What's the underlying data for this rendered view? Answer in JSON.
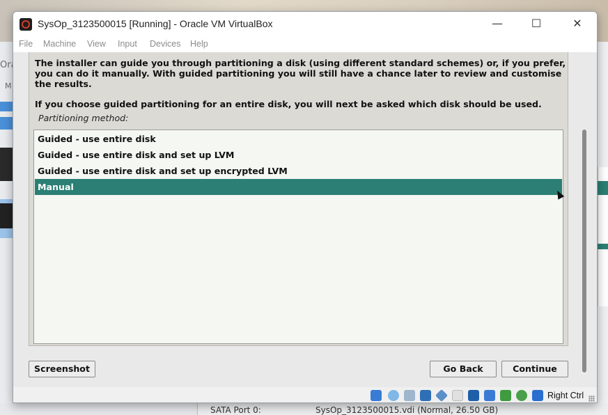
{
  "background": {
    "left_fragments": [
      "Ora",
      "M"
    ],
    "bottom_info": {
      "label": "SATA Port 0:",
      "value": "SysOp_3123500015.vdi (Normal, 26.50 GB)"
    }
  },
  "window": {
    "title": "SysOp_3123500015 [Running] - Oracle VM VirtualBox",
    "controls": {
      "minimize": "—",
      "maximize": "☐",
      "close": "✕"
    },
    "menu": [
      "File",
      "Machine",
      "View",
      "Input",
      "Devices",
      "Help"
    ]
  },
  "installer": {
    "intro": "The installer can guide you through partitioning a disk (using different standard schemes) or, if you prefer, you can do it manually. With guided partitioning you will still have a chance later to review and customise the results.",
    "intro2": "If you choose guided partitioning for an entire disk, you will next be asked which disk should be used.",
    "method_label": "Partitioning method:",
    "options": [
      "Guided - use entire disk",
      "Guided - use entire disk and set up LVM",
      "Guided - use entire disk and set up encrypted LVM",
      "Manual"
    ],
    "selected_index": 3,
    "buttons": {
      "screenshot": "Screenshot",
      "go_back": "Go Back",
      "continue": "Continue"
    }
  },
  "statusbar": {
    "icons": [
      "hard-disk-icon",
      "optical-drive-icon",
      "audio-icon",
      "network-icon",
      "usb-icon",
      "shared-folders-icon",
      "display-icon",
      "video-capture-icon",
      "cpu-icon",
      "mouse-integration-icon",
      "keyboard-icon"
    ],
    "host_key": "Right Ctrl"
  },
  "colors": {
    "selection": "#2b7f74",
    "panel": "#dcdad5",
    "list_background": "#f4f7f2"
  }
}
